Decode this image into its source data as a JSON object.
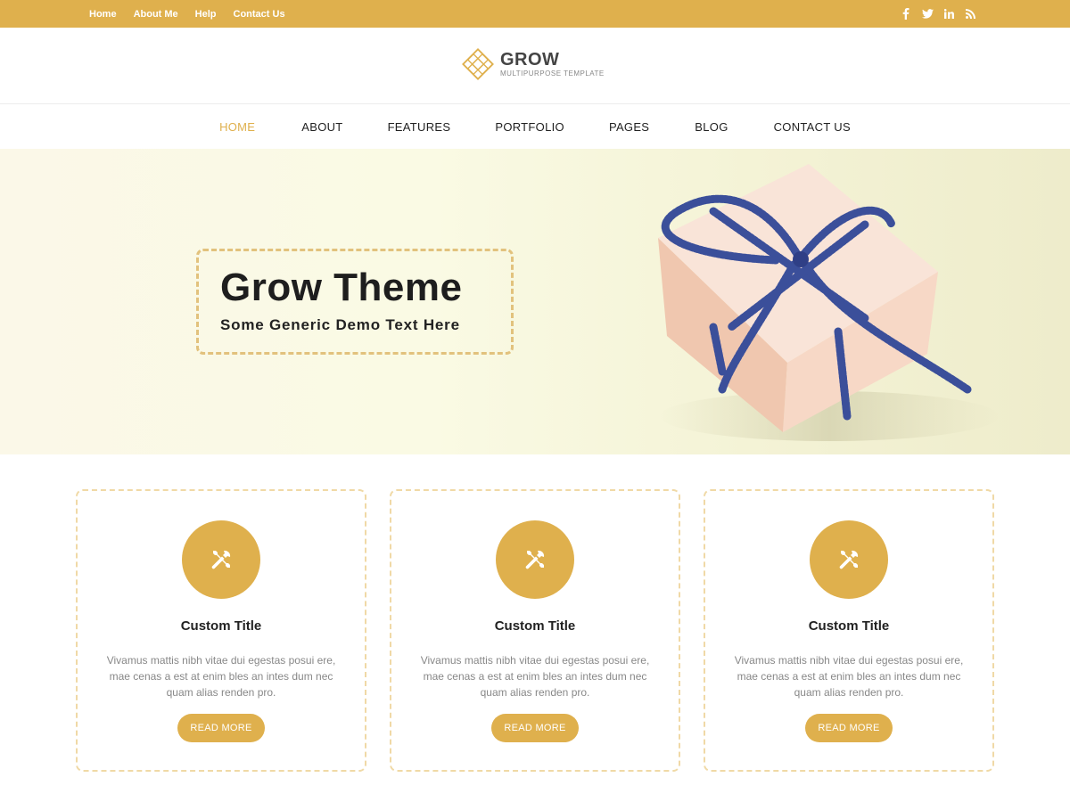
{
  "topbar": {
    "links": [
      "Home",
      "About Me",
      "Help",
      "Contact Us"
    ],
    "social_icons": [
      "facebook-icon",
      "twitter-icon",
      "linkedin-icon",
      "rss-icon"
    ]
  },
  "header": {
    "logo_title": "GROW",
    "logo_tagline": "MULTIPURPOSE TEMPLATE"
  },
  "nav": {
    "items": [
      "HOME",
      "ABOUT",
      "FEATURES",
      "PORTFOLIO",
      "PAGES",
      "BLOG",
      "CONTACT US"
    ],
    "active_index": 0
  },
  "hero": {
    "title": "Grow Theme",
    "subtitle": "Some Generic Demo Text Here"
  },
  "cards": [
    {
      "icon": "tools-icon",
      "title": "Custom Title",
      "text": "Vivamus mattis nibh vitae dui egestas posui ere, mae cenas a est at enim bles an intes dum nec quam alias renden pro.",
      "button": "READ MORE"
    },
    {
      "icon": "tools-icon",
      "title": "Custom Title",
      "text": "Vivamus mattis nibh vitae dui egestas posui ere, mae cenas a est at enim bles an intes dum nec quam alias renden pro.",
      "button": "READ MORE"
    },
    {
      "icon": "tools-icon",
      "title": "Custom Title",
      "text": "Vivamus mattis nibh vitae dui egestas posui ere, mae cenas a est at enim bles an intes dum nec quam alias renden pro.",
      "button": "READ MORE"
    }
  ],
  "colors": {
    "accent": "#dfb04d",
    "card_border": "#f0d9a6",
    "hero_border": "#e2c27d",
    "text_dark": "#222222",
    "text_muted": "#888888"
  }
}
